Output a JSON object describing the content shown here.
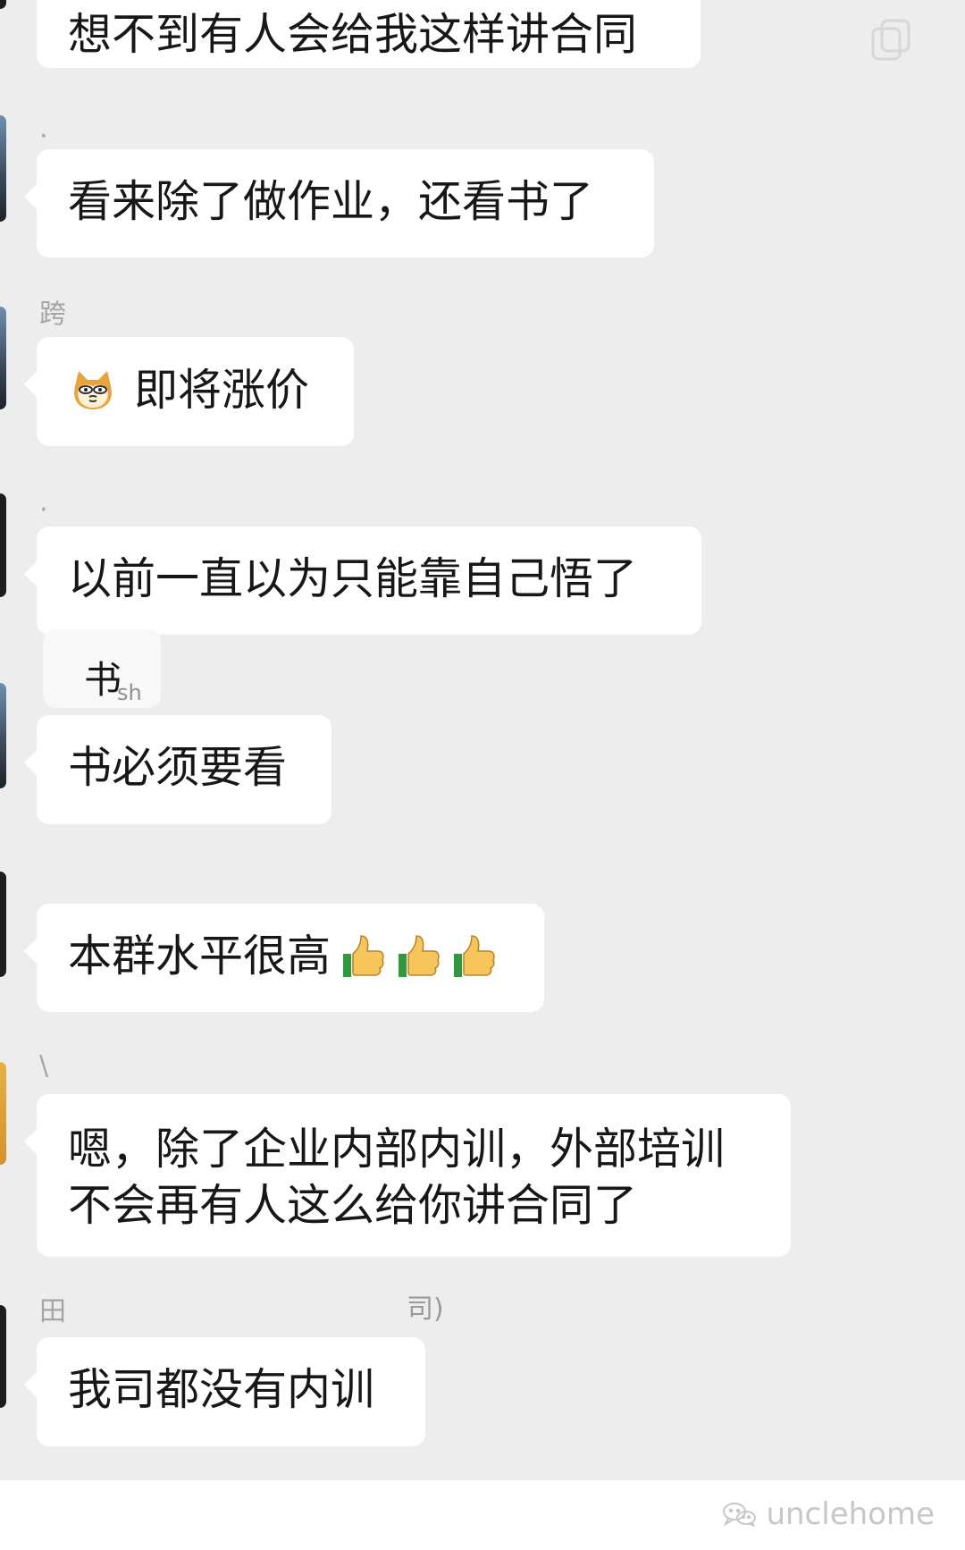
{
  "messages": [
    {
      "sender": "",
      "text": "想不到有人会给我这样讲合同"
    },
    {
      "sender": "·",
      "text": "看来除了做作业，还看书了"
    },
    {
      "sender": "跨",
      "text": "即将涨价"
    },
    {
      "sender": "·",
      "text": "以前一直以为只能靠自己悟了"
    },
    {
      "sender": "书",
      "sender_suffix": "sh",
      "text": "书必须要看"
    },
    {
      "sender": "",
      "text": "本群水平很高"
    },
    {
      "sender": "\\",
      "text": "嗯，除了企业内部内训，外部培训不会再有人这么给你讲合同了"
    },
    {
      "sender": "田",
      "sender_tail": "司)",
      "text": "我司都没有内训"
    }
  ],
  "footer": {
    "brand": "unclehome"
  },
  "icons": {
    "copy": "copy-icon",
    "dog": "shiba-face-icon",
    "thumb": "thumbs-up-icon",
    "wechat": "wechat-logo-icon"
  },
  "colors": {
    "background": "#ededed",
    "bubble": "#ffffff",
    "text": "#171717",
    "muted": "#a5a5a5",
    "footer": "#ffffff"
  }
}
